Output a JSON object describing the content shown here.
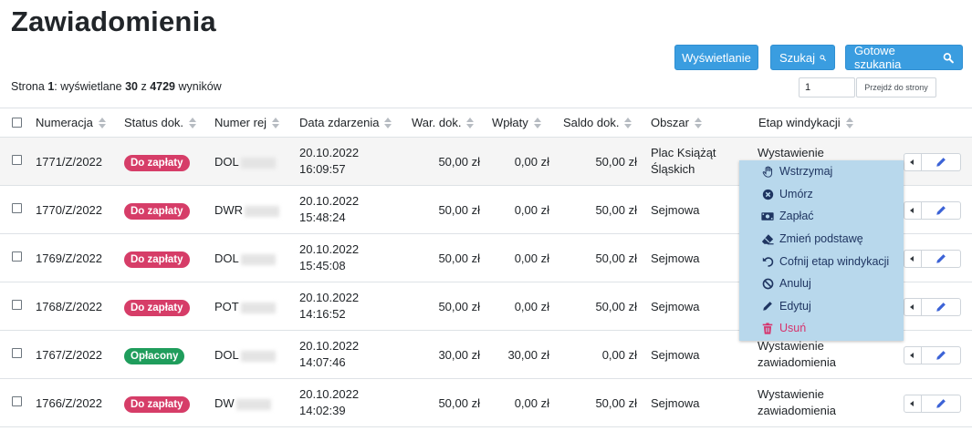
{
  "page": {
    "title": "Zawiadomienia"
  },
  "toolbar": {
    "display_label": "Wyświetlanie",
    "search_label": "Szukaj",
    "saved_search_label": "Gotowe szukania"
  },
  "summary": {
    "prefix": "Strona ",
    "page": "1",
    "mid1": ": wyświetlane ",
    "shown": "30",
    "mid2": " z ",
    "total": "4729",
    "suffix": " wyników"
  },
  "pagination": {
    "page_value": "1",
    "go_label": "Przejdź do strony"
  },
  "table": {
    "headers": [
      "Numeracja",
      "Status dok.",
      "Numer rej",
      "Data zdarzenia",
      "War. dok.",
      "Wpłaty",
      "Saldo dok.",
      "Obszar",
      "Etap windykacji"
    ],
    "rows": [
      {
        "num": "1771/Z/2022",
        "status": "Do zapłaty",
        "status_color": "#d63d68",
        "reg": "DOL",
        "date": "20.10.2022",
        "time": "16:09:57",
        "war": "50,00 zł",
        "wpl": "0,00 zł",
        "saldo": "50,00 zł",
        "area1": "Plac Książąt",
        "area2": "Śląskich",
        "etap1": "Wystawienie",
        "etap2": ""
      },
      {
        "num": "1770/Z/2022",
        "status": "Do zapłaty",
        "status_color": "#d63d68",
        "reg": "DWR",
        "date": "20.10.2022",
        "time": "15:48:24",
        "war": "50,00 zł",
        "wpl": "0,00 zł",
        "saldo": "50,00 zł",
        "area1": "Sejmowa",
        "area2": "",
        "etap1": "",
        "etap2": ""
      },
      {
        "num": "1769/Z/2022",
        "status": "Do zapłaty",
        "status_color": "#d63d68",
        "reg": "DOL",
        "date": "20.10.2022",
        "time": "15:45:08",
        "war": "50,00 zł",
        "wpl": "0,00 zł",
        "saldo": "50,00 zł",
        "area1": "Sejmowa",
        "area2": "",
        "etap1": "",
        "etap2": ""
      },
      {
        "num": "1768/Z/2022",
        "status": "Do zapłaty",
        "status_color": "#d63d68",
        "reg": "POT",
        "date": "20.10.2022",
        "time": "14:16:52",
        "war": "50,00 zł",
        "wpl": "0,00 zł",
        "saldo": "50,00 zł",
        "area1": "Sejmowa",
        "area2": "",
        "etap1": "",
        "etap2": ""
      },
      {
        "num": "1767/Z/2022",
        "status": "Opłacony",
        "status_color": "#1f9d5c",
        "reg": "DOL",
        "date": "20.10.2022",
        "time": "14:07:46",
        "war": "30,00 zł",
        "wpl": "30,00 zł",
        "saldo": "0,00 zł",
        "area1": "Sejmowa",
        "area2": "",
        "etap1": "Wystawienie",
        "etap2": "zawiadomienia"
      },
      {
        "num": "1766/Z/2022",
        "status": "Do zapłaty",
        "status_color": "#d63d68",
        "reg": "DW",
        "date": "20.10.2022",
        "time": "14:02:39",
        "war": "50,00 zł",
        "wpl": "0,00 zł",
        "saldo": "50,00 zł",
        "area1": "Sejmowa",
        "area2": "",
        "etap1": "Wystawienie",
        "etap2": "zawiadomienia"
      }
    ]
  },
  "menu": {
    "items": [
      {
        "label": "Wstrzymaj",
        "icon": "hand-icon"
      },
      {
        "label": "Umórz",
        "icon": "times-circle-icon"
      },
      {
        "label": "Zapłać",
        "icon": "money-icon"
      },
      {
        "label": "Zmień podstawę",
        "icon": "eraser-icon"
      },
      {
        "label": "Cofnij etap windykacji",
        "icon": "undo-icon"
      },
      {
        "label": "Anuluj",
        "icon": "ban-icon"
      },
      {
        "label": "Edytuj",
        "icon": "pencil-icon"
      },
      {
        "label": "Usuń",
        "icon": "trash-icon"
      }
    ]
  },
  "colors": {
    "primary": "#3a9de0",
    "danger": "#d63d68",
    "success": "#1f9d5c",
    "menu_bg": "#b8d8ec",
    "menu_text": "#1f3561",
    "edit_icon": "#3b62d6"
  }
}
